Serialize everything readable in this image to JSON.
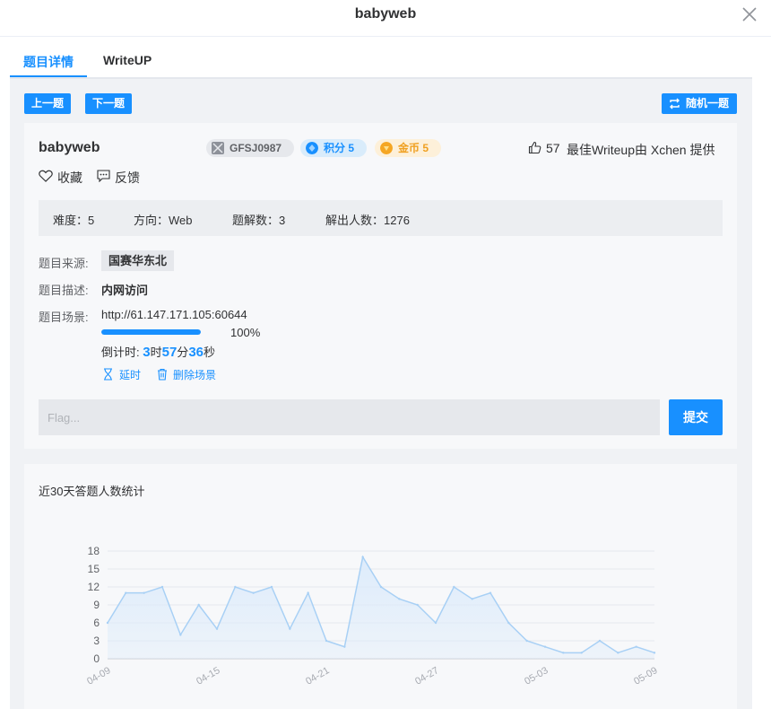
{
  "window": {
    "title": "babyweb"
  },
  "tabs": [
    {
      "label": "题目详情"
    },
    {
      "label": "WriteUP"
    }
  ],
  "toolbar": {
    "prev_label": "上一题",
    "next_label": "下一题",
    "random_label": "随机一题"
  },
  "challenge": {
    "name": "babyweb",
    "code_badge": "GFSJ0987",
    "score_badge": "积分 5",
    "coin_badge": "金币 5",
    "likes": "57",
    "best_writeup": "最佳Writeup由 Xchen 提供",
    "favorite_label": "收藏",
    "feedback_label": "反馈"
  },
  "stats": {
    "difficulty": "难度：5",
    "direction": "方向：Web",
    "solves": "题解数：3",
    "solvers": "解出人数：1276"
  },
  "details": {
    "source_label": "题目来源:",
    "source_value": "国赛华东北",
    "desc_label": "题目描述:",
    "desc_value": "内网访问",
    "scene_label": "题目场景:",
    "scene_url": "http://61.147.171.105:60644",
    "progress_text": "100%",
    "progress_value": 100,
    "countdown_label": "倒计时:",
    "hours": "3",
    "hours_unit": "时",
    "minutes": "57",
    "minutes_unit": "分",
    "seconds": "36",
    "seconds_unit": "秒",
    "extend_label": "延时",
    "delete_label": "删除场景"
  },
  "flag": {
    "placeholder": "Flag...",
    "submit_label": "提交"
  },
  "colors": {
    "accent": "#1890ff",
    "coin": "#f0a020",
    "line": "#a8d0f5",
    "area": "#dcebfb"
  },
  "chart_data": {
    "type": "area",
    "title": "近30天答题人数统计",
    "x": [
      "04-09",
      "04-10",
      "04-11",
      "04-12",
      "04-13",
      "04-14",
      "04-15",
      "04-16",
      "04-17",
      "04-18",
      "04-19",
      "04-20",
      "04-21",
      "04-22",
      "04-23",
      "04-24",
      "04-25",
      "04-26",
      "04-27",
      "04-28",
      "04-29",
      "04-30",
      "05-01",
      "05-02",
      "05-03",
      "05-04",
      "05-05",
      "05-06",
      "05-07",
      "05-08",
      "05-09"
    ],
    "xticks": [
      "04-09",
      "04-15",
      "04-21",
      "04-27",
      "05-03",
      "05-09"
    ],
    "values": [
      6,
      11,
      11,
      12,
      4,
      9,
      5,
      12,
      11,
      12,
      5,
      11,
      3,
      2,
      17,
      12,
      10,
      9,
      6,
      12,
      10,
      11,
      6,
      3,
      2,
      1,
      1,
      3,
      1,
      2,
      1
    ],
    "yticks": [
      0,
      3,
      6,
      9,
      12,
      15,
      18
    ],
    "ylim": [
      0,
      18
    ],
    "grid": true
  }
}
